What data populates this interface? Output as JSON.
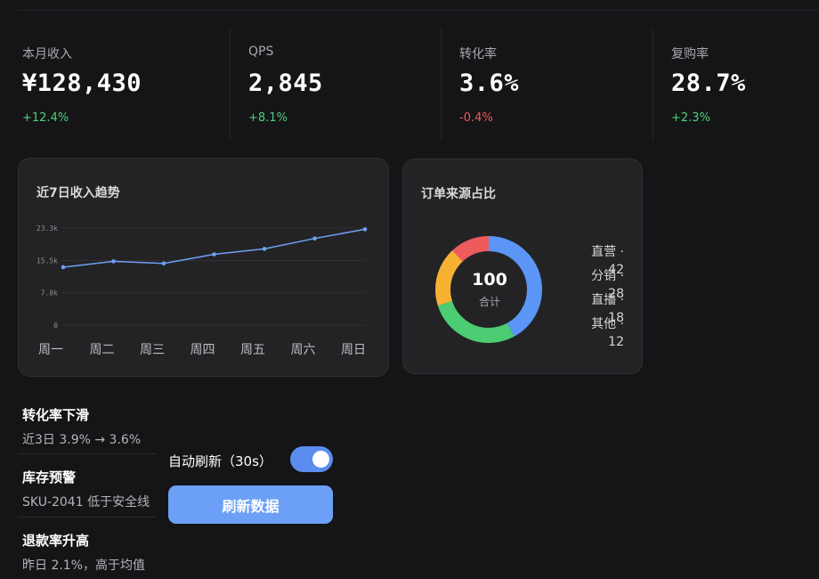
{
  "kpis": [
    {
      "label": "本月收入",
      "value": "¥128,430",
      "delta": "+12.4%",
      "trend": "up"
    },
    {
      "label": "QPS",
      "value": "2,845",
      "delta": "+8.1%",
      "trend": "up"
    },
    {
      "label": "转化率",
      "value": "3.6%",
      "delta": "-0.4%",
      "trend": "down"
    },
    {
      "label": "复购率",
      "value": "28.7%",
      "delta": "+2.3%",
      "trend": "up"
    }
  ],
  "chart_data": [
    {
      "type": "line",
      "title": "近7日收入趋势",
      "categories": [
        "周一",
        "周二",
        "周三",
        "周四",
        "周五",
        "周六",
        "周日"
      ],
      "values": [
        13900,
        15300,
        14800,
        17000,
        18300,
        20800,
        23000
      ],
      "y_ticks": [
        "0",
        "7.8k",
        "15.5k",
        "23.3k"
      ],
      "y_tick_values": [
        0,
        7800,
        15500,
        23300
      ],
      "ylim": [
        0,
        23300
      ],
      "grid": true,
      "color": "#6ea1f5"
    },
    {
      "type": "pie",
      "title": "订单来源占比",
      "center_value": "100",
      "center_label": "合计",
      "slices": [
        {
          "label": "直营",
          "value": 42,
          "legend": "直营 · 42",
          "color": "#5b95f5"
        },
        {
          "label": "分销",
          "value": 28,
          "legend": "分销 · 28",
          "color": "#4ccc73"
        },
        {
          "label": "直播",
          "value": 18,
          "legend": "直播 · 18",
          "color": "#f6b132"
        },
        {
          "label": "其他",
          "value": 12,
          "legend": "其他 · 12",
          "color": "#ee5b5f"
        }
      ]
    }
  ],
  "alerts": [
    {
      "title": "转化率下滑",
      "desc": "近3日 3.9% → 3.6%"
    },
    {
      "title": "库存预警",
      "desc": "SKU-2041 低于安全线"
    },
    {
      "title": "退款率升高",
      "desc": "昨日 2.1%，高于均值"
    }
  ],
  "controls": {
    "auto_refresh_label": "自动刷新（30s）",
    "auto_refresh_on": true,
    "refresh_button": "刷新数据"
  },
  "colors": {
    "up": "#4cd17a",
    "down": "#ef5a5a",
    "accent": "#6ba0f6"
  }
}
